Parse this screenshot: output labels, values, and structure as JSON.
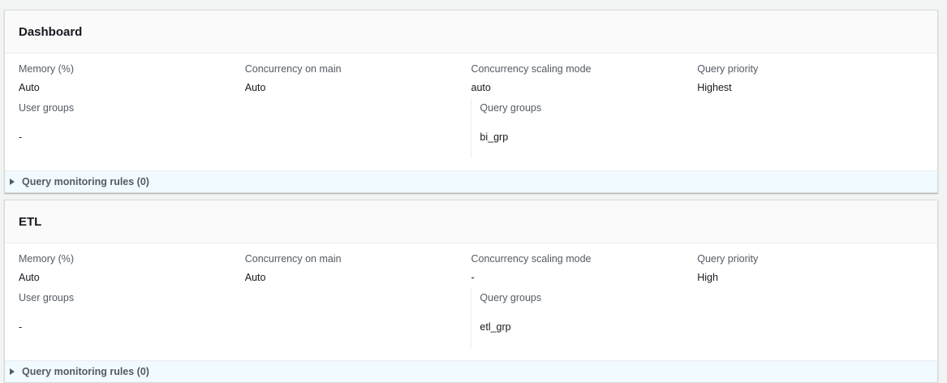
{
  "panels": [
    {
      "title": "Dashboard",
      "memory_label": "Memory (%)",
      "memory_value": "Auto",
      "concurrency_label": "Concurrency on main",
      "concurrency_value": "Auto",
      "scaling_label": "Concurrency scaling mode",
      "scaling_value": "auto",
      "priority_label": "Query priority",
      "priority_value": "Highest",
      "user_groups_label": "User groups",
      "user_groups_value": "-",
      "query_groups_label": "Query groups",
      "query_groups_value": "bi_grp",
      "rules_label": "Query monitoring rules (0)"
    },
    {
      "title": "ETL",
      "memory_label": "Memory (%)",
      "memory_value": "Auto",
      "concurrency_label": "Concurrency on main",
      "concurrency_value": "Auto",
      "scaling_label": "Concurrency scaling mode",
      "scaling_value": "-",
      "priority_label": "Query priority",
      "priority_value": "High",
      "user_groups_label": "User groups",
      "user_groups_value": "-",
      "query_groups_label": "Query groups",
      "query_groups_value": "etl_grp",
      "rules_label": "Query monitoring rules (0)"
    }
  ],
  "colors": {
    "page_bg": "#f2f3f3",
    "panel_header_bg": "#fafafa",
    "footer_bg": "#f1faff",
    "label": "#545b64",
    "text": "#16191f"
  },
  "icons": {
    "expand": "caret-right-icon"
  }
}
